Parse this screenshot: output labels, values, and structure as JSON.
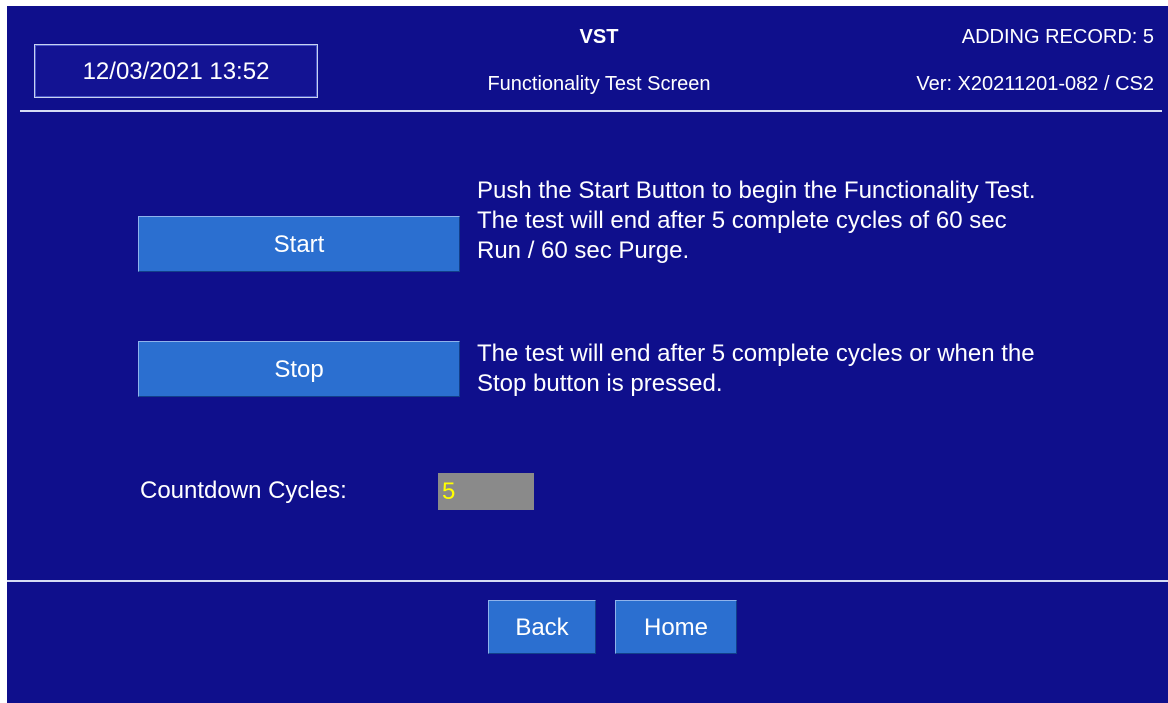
{
  "header": {
    "datetime": "12/03/2021 13:52",
    "title": "VST",
    "subtitle": "Functionality Test Screen",
    "record_status": "ADDING RECORD: 5",
    "version": "Ver: X20211201-082 / CS2"
  },
  "main": {
    "start_label": "Start",
    "start_description": "Push the Start Button to begin the Functionality Test. The test will end after 5 complete cycles of 60 sec Run / 60 sec Purge.",
    "stop_label": "Stop",
    "stop_description": "The test will end after 5 complete cycles or when the Stop button is pressed.",
    "countdown_label": "Countdown Cycles:",
    "countdown_value": "5"
  },
  "footer": {
    "back_label": "Back",
    "home_label": "Home"
  },
  "colors": {
    "background": "#0f0f8c",
    "button": "#2b6fd0",
    "field_bg": "#8a8a8a",
    "field_text": "#ffff00"
  }
}
